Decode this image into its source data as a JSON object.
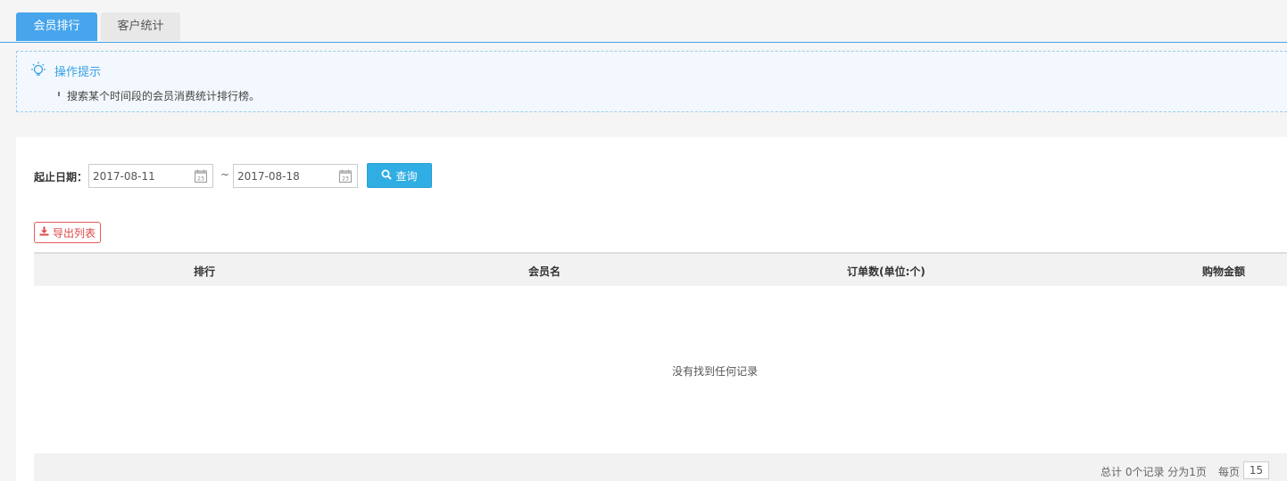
{
  "tabs": [
    {
      "label": "会员排行",
      "active": true
    },
    {
      "label": "客户统计",
      "active": false
    }
  ],
  "tip": {
    "title": "操作提示",
    "icon": "lightbulb-icon",
    "items": [
      "搜索某个时间段的会员消费统计排行榜。"
    ]
  },
  "filter": {
    "date_label": "起止日期：",
    "start_date": "2017-08-11",
    "end_date": "2017-08-18",
    "separator": "~",
    "query_label": "查询"
  },
  "export_label": "导出列表",
  "table": {
    "columns": [
      "排行",
      "会员名",
      "订单数(单位:个)",
      "购物金额"
    ],
    "rows": [],
    "empty_text": "没有找到任何记录"
  },
  "pagination": {
    "summary": "总计 0个记录 分为1页",
    "per_page_label": "每页",
    "per_page_value": "15"
  },
  "colors": {
    "accent": "#46a5ec",
    "query_button": "#30aee4",
    "export_button": "#e04848"
  }
}
